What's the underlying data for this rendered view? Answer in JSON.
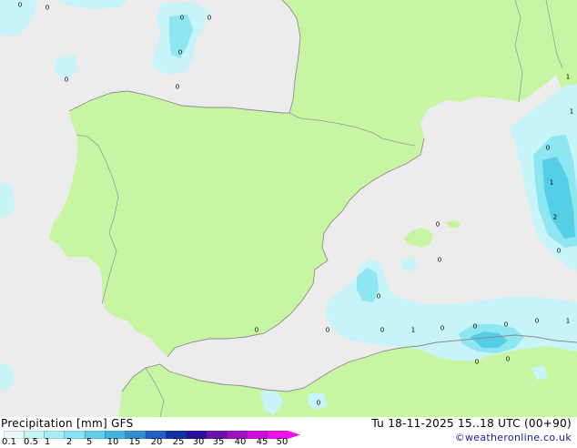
{
  "colors": {
    "sea": "#ececec",
    "land": "#c8f5a2",
    "border": "#999999",
    "coast": "#8c8c8c",
    "precip_light": "#c6f4f8",
    "precip_mid": "#8ee6f1",
    "precip_strong": "#55cfe8"
  },
  "map": {
    "cell_values": [
      {
        "text": "0"
      },
      {
        "text": "0"
      },
      {
        "text": "0"
      },
      {
        "text": "0"
      },
      {
        "text": "0"
      },
      {
        "text": "0"
      },
      {
        "text": "0"
      },
      {
        "text": "1"
      },
      {
        "text": "1"
      },
      {
        "text": "0"
      },
      {
        "text": "1"
      },
      {
        "text": "2"
      },
      {
        "text": "0"
      },
      {
        "text": "0"
      },
      {
        "text": "0"
      },
      {
        "text": "0"
      },
      {
        "text": "0"
      },
      {
        "text": "0"
      },
      {
        "text": "1"
      },
      {
        "text": "0"
      },
      {
        "text": "0"
      },
      {
        "text": "0"
      },
      {
        "text": "0"
      },
      {
        "text": "1"
      },
      {
        "text": "0"
      },
      {
        "text": "0"
      },
      {
        "text": "0"
      },
      {
        "text": "0"
      }
    ]
  },
  "footer": {
    "title": "Precipitation [mm]  GFS",
    "valid_time": "Tu 18-11-2025 15..18 UTC (00+90)",
    "credit": "©weatheronline.co.uk"
  },
  "legend": {
    "ticks": [
      "0.1",
      "0.5",
      "1",
      "2",
      "5",
      "10",
      "15",
      "20",
      "25",
      "30",
      "35",
      "40",
      "45",
      "50"
    ],
    "colors": [
      "#e8f8fb",
      "#c6f4f8",
      "#a6eef6",
      "#86e3f2",
      "#5fcfe8",
      "#3fb6e0",
      "#2f8fd4",
      "#2060c4",
      "#1030a8",
      "#2a0f9c",
      "#6a0fb0",
      "#a00fc4",
      "#d00fd8",
      "#f00ff0"
    ]
  }
}
